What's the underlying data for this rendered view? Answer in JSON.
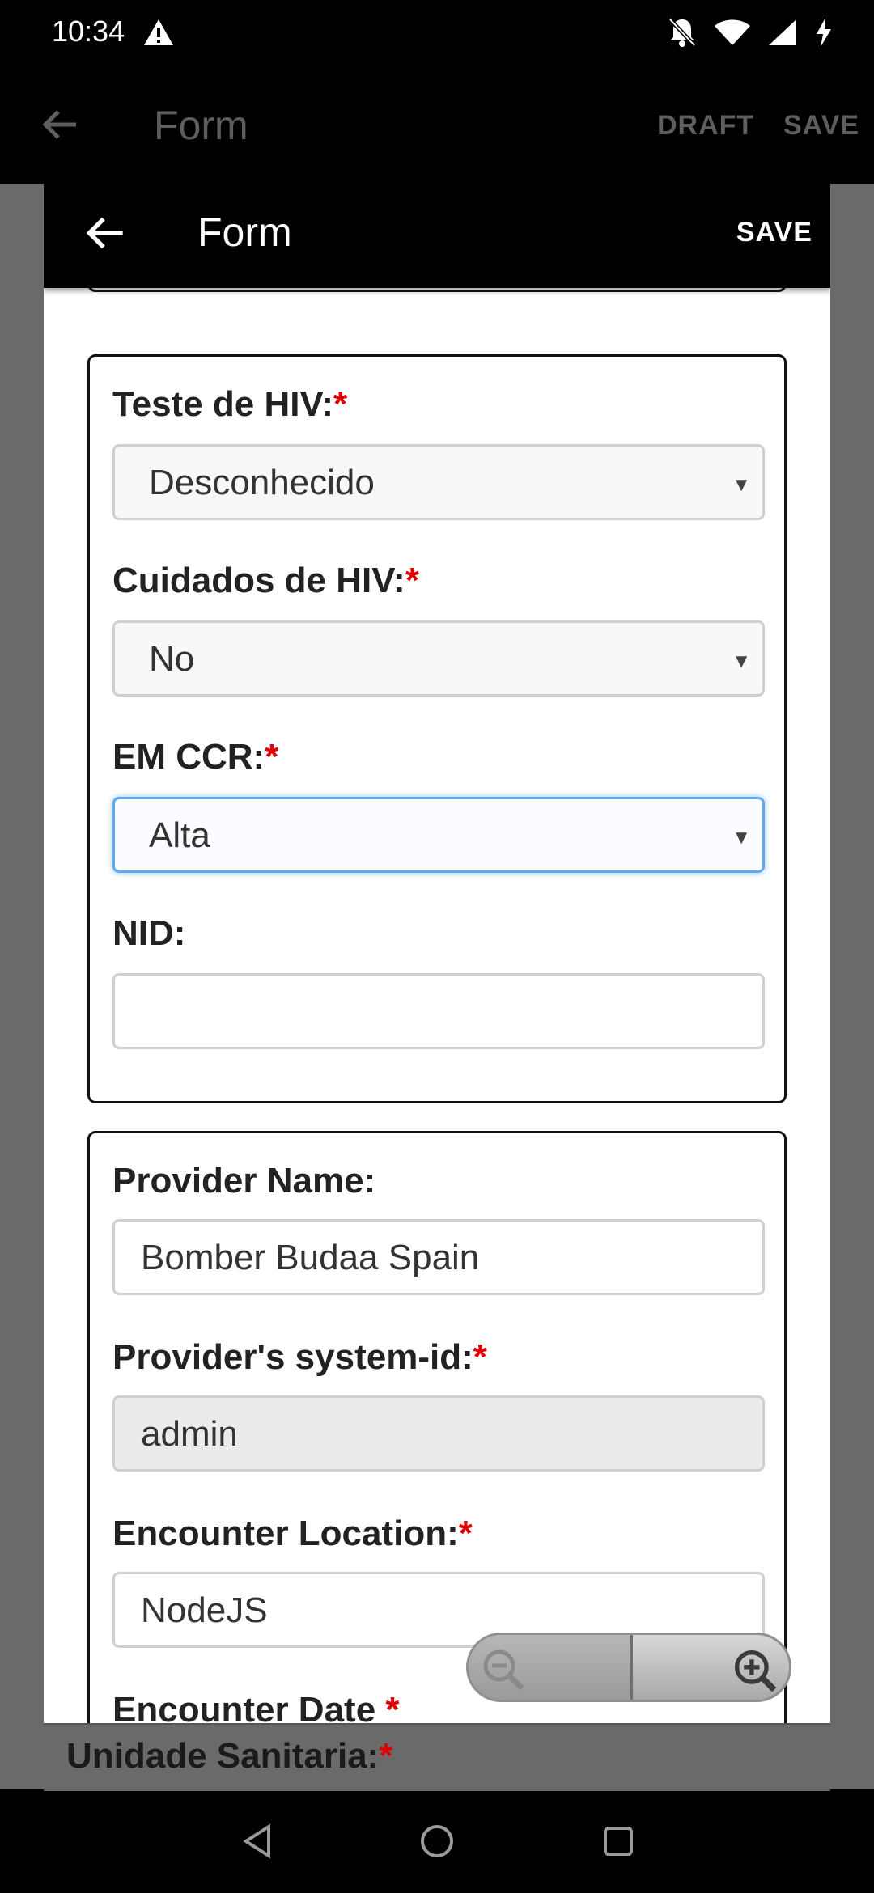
{
  "status_bar": {
    "time": "10:34"
  },
  "app_bar": {
    "title": "Form",
    "draft_label": "DRAFT",
    "save_label": "SAVE"
  },
  "dialog": {
    "title": "Form",
    "save_label": "SAVE"
  },
  "section1": {
    "hiv_test": {
      "label": "Teste de HIV:",
      "required": "*",
      "value": "Desconhecido"
    },
    "hiv_care": {
      "label": "Cuidados de HIV:",
      "required": "*",
      "value": "No"
    },
    "em_ccr": {
      "label": "EM CCR:",
      "required": "*",
      "value": "Alta"
    },
    "nid": {
      "label": "NID:",
      "value": ""
    }
  },
  "section2": {
    "provider_name": {
      "label": "Provider Name:",
      "value": "Bomber Budaa Spain"
    },
    "provider_system_id": {
      "label": "Provider's system-id:",
      "required": "*",
      "value": "admin"
    },
    "encounter_location": {
      "label": "Encounter Location:",
      "required": "*",
      "value": "NodeJS"
    },
    "encounter_date": {
      "label": "Encounter Date ",
      "required": "*"
    }
  },
  "background_form": {
    "label": "Unidade Sanitaria:",
    "required": "*"
  },
  "colors": {
    "required": "#e00000",
    "focus_border": "#5ea9f0"
  }
}
